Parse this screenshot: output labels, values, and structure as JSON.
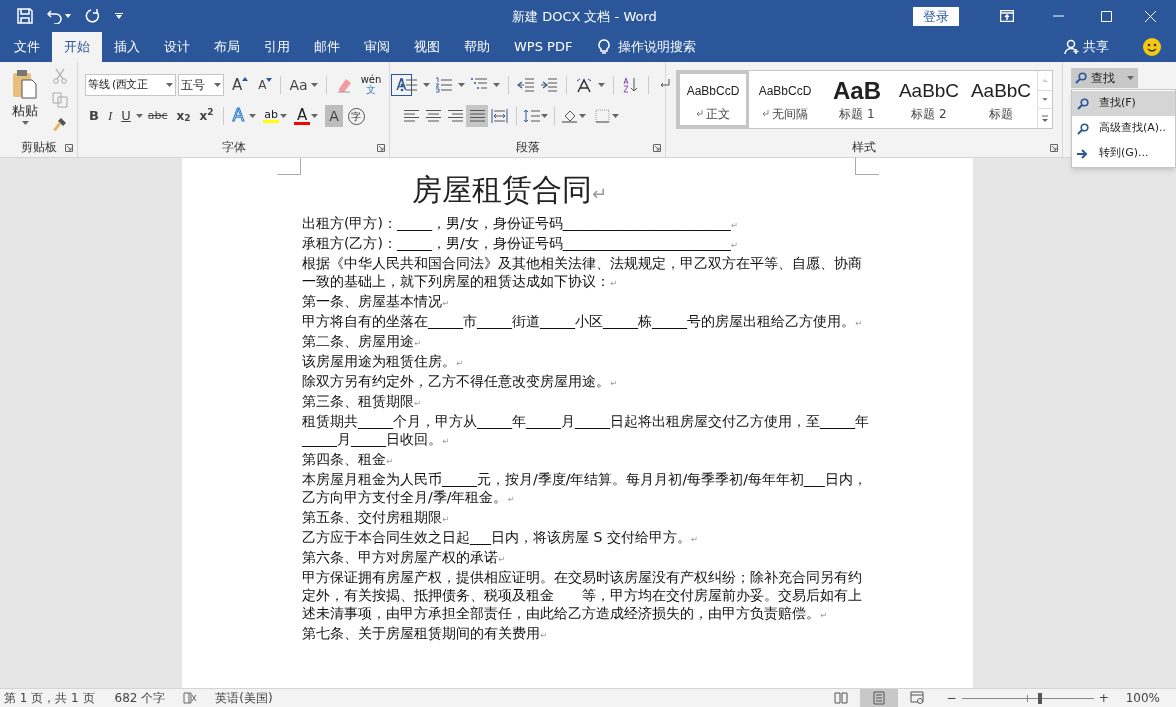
{
  "window": {
    "title": "新建 DOCX 文档 - Word",
    "login": "登录"
  },
  "ribbon_tabs": [
    {
      "label": "文件",
      "selected": false
    },
    {
      "label": "开始",
      "selected": true
    },
    {
      "label": "插入",
      "selected": false
    },
    {
      "label": "设计",
      "selected": false
    },
    {
      "label": "布局",
      "selected": false
    },
    {
      "label": "引用",
      "selected": false
    },
    {
      "label": "邮件",
      "selected": false
    },
    {
      "label": "审阅",
      "selected": false
    },
    {
      "label": "视图",
      "selected": false
    },
    {
      "label": "帮助",
      "selected": false
    },
    {
      "label": "WPS PDF",
      "selected": false
    }
  ],
  "tell_me": "操作说明搜索",
  "share": "共享",
  "clipboard": {
    "paste": "粘贴",
    "label": "剪贴板"
  },
  "font": {
    "name": "等线 (西文正",
    "size": "五号",
    "label": "字体",
    "grow": "A",
    "shrink": "A",
    "case": "Aa",
    "phonetic": "wén",
    "phonetic_char": "文",
    "char_border": "A",
    "bold": "B",
    "italic": "I",
    "underline": "U",
    "strike": "abc",
    "subscript": "x$_{2}$",
    "superscript": "x$^{2}$",
    "effects": "A",
    "highlight": "ab",
    "text_color": "A",
    "shading": "A",
    "enclose": "字"
  },
  "paragraph": {
    "label": "段落",
    "alignment": [
      {
        "selected": false
      },
      {
        "selected": false
      },
      {
        "selected": false
      },
      {
        "selected": true
      },
      {
        "selected": false
      }
    ]
  },
  "styles": {
    "label": "样式",
    "items": [
      {
        "preview": "AaBbCcD",
        "label": "正文",
        "kind": "normal",
        "selected": true
      },
      {
        "preview": "AaBbCcD",
        "label": "无间隔",
        "kind": "normal",
        "selected": false
      },
      {
        "preview": "AaB",
        "label": "标题 1",
        "kind": "heading1",
        "selected": false
      },
      {
        "preview": "AaBbC",
        "label": "标题 2",
        "kind": "heading2",
        "selected": false
      },
      {
        "preview": "AaBbC",
        "label": "标题",
        "kind": "title",
        "selected": false
      }
    ]
  },
  "editing": {
    "find": "查找",
    "pressed": true
  },
  "find_menu": [
    {
      "label": "查找(F)",
      "kind": "find",
      "selected": true
    },
    {
      "label": "高级查找(A)..",
      "kind": "find",
      "selected": false
    },
    {
      "label": "转到(G)...",
      "kind": "goto",
      "selected": false
    }
  ],
  "document": {
    "title": "房屋租赁合同↵",
    "paragraphs": [
      "出租方(甲方)：_____，男/女，身份证号码________________________↵",
      "承租方(乙方)：_____，男/女，身份证号码________________________↵",
      "根据《中华人民共和国合同法》及其他相关法律、法规规定，甲乙双方在平等、自愿、协商一致的基础上，就下列房屋的租赁达成如下协议：↵",
      "第一条、房屋基本情况↵",
      "甲方将自有的坐落在_____市_____街道_____小区_____栋_____号的房屋出租给乙方使用。↵",
      "第二条、房屋用途↵",
      "该房屋用途为租赁住房。↵",
      "除双方另有约定外，乙方不得任意改变房屋用途。↵",
      "第三条、租赁期限↵",
      "租赁期共_____个月，甲方从_____年_____月_____日起将出租房屋交付乙方使用，至_____年_____月_____日收回。↵",
      "第四条、租金↵",
      "本房屋月租金为人民币_____元，按月/季度/年结算。每月月初/每季季初/每年年初___日内，乙方向甲方支付全月/季/年租金。↵",
      "第五条、交付房租期限↵",
      "乙方应于本合同生效之日起___日内，将该房屋 S 交付给甲方。↵",
      "第六条、甲方对房屋产权的承诺↵",
      "甲方保证拥有房屋产权，提供相应证明。在交易时该房屋没有产权纠纷；除补充合同另有约定外，有关按揭、抵押债务、税项及租金　　等，甲方均在交付房屋前办妥。交易后如有上述未清事项，由甲方承担全部责任，由此给乙方造成经济损失的，由甲方负责赔偿。↵",
      "第七条、关于房屋租赁期间的有关费用↵"
    ]
  },
  "status_bar": {
    "page": "第 1 页，共 1 页",
    "words": "682 个字",
    "language": "英语(美国)",
    "views": [
      {
        "selected": false
      },
      {
        "selected": true
      },
      {
        "selected": false
      }
    ],
    "minus": "−",
    "plus": "+",
    "zoom": {
      "level": 0.6
    },
    "zoom_text": "100%"
  }
}
